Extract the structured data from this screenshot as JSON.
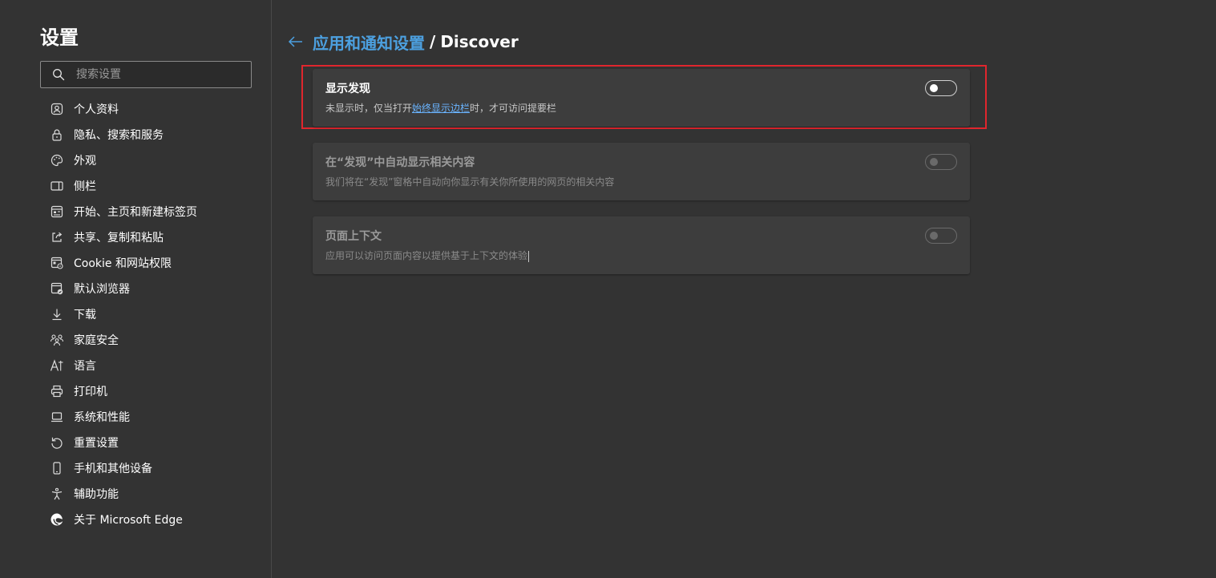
{
  "sidebar": {
    "title": "设置",
    "search": {
      "placeholder": "搜索设置",
      "value": ""
    },
    "items": [
      {
        "label": "个人资料",
        "icon": "profile-icon"
      },
      {
        "label": "隐私、搜索和服务",
        "icon": "lock-icon"
      },
      {
        "label": "外观",
        "icon": "palette-icon"
      },
      {
        "label": "侧栏",
        "icon": "sidebar-icon"
      },
      {
        "label": "开始、主页和新建标签页",
        "icon": "home-tab-icon"
      },
      {
        "label": "共享、复制和粘贴",
        "icon": "share-icon"
      },
      {
        "label": "Cookie 和网站权限",
        "icon": "cookie-site-icon"
      },
      {
        "label": "默认浏览器",
        "icon": "browser-icon"
      },
      {
        "label": "下载",
        "icon": "download-icon"
      },
      {
        "label": "家庭安全",
        "icon": "family-icon"
      },
      {
        "label": "语言",
        "icon": "language-icon"
      },
      {
        "label": "打印机",
        "icon": "printer-icon"
      },
      {
        "label": "系统和性能",
        "icon": "laptop-icon"
      },
      {
        "label": "重置设置",
        "icon": "reset-icon"
      },
      {
        "label": "手机和其他设备",
        "icon": "phone-icon"
      },
      {
        "label": "辅助功能",
        "icon": "accessibility-icon"
      },
      {
        "label": "关于 Microsoft Edge",
        "icon": "edge-icon"
      }
    ]
  },
  "header": {
    "back_icon": "arrow-left-icon",
    "parent": "应用和通知设置",
    "separator": "/",
    "current": "Discover"
  },
  "cards": [
    {
      "title": "显示发现",
      "desc_before": "未显示时，仅当打开",
      "desc_link": "始终显示边栏",
      "desc_after": "时，才可访问提要栏",
      "toggle_on": false,
      "enabled": true
    },
    {
      "title": "在“发现”中自动显示相关内容",
      "desc": "我们将在“发现”窗格中自动向你显示有关你所使用的网页的相关内容",
      "toggle_on": false,
      "enabled": false
    },
    {
      "title": "页面上下文",
      "desc": "应用可以访问页面内容以提供基于上下文的体验",
      "toggle_on": false,
      "enabled": false
    }
  ],
  "colors": {
    "background": "#333333",
    "card": "#3d3d3d",
    "accent": "#4ca0e0",
    "link": "#6ab4ff",
    "highlight": "#e0262d"
  }
}
